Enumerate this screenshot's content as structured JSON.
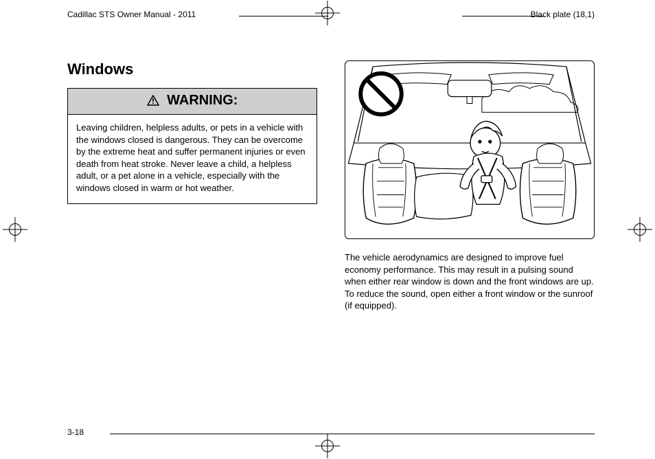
{
  "header": {
    "left": "Cadillac STS Owner Manual - 2011",
    "right": "Black plate (18,1)"
  },
  "section_title": "Windows",
  "warning": {
    "label": "WARNING:",
    "icon_name": "warning-triangle-icon",
    "body": "Leaving children, helpless adults, or pets in a vehicle with the windows closed is dangerous. They can be overcome by the extreme heat and suffer permanent injuries or even death from heat stroke. Never leave a child, a helpless adult, or a pet alone in a vehicle, especially with the windows closed in warm or hot weather."
  },
  "illustration": {
    "alt": "Line drawing: child in rear seat of a car with a prohibition (no-unattended) symbol in the upper-left corner.",
    "prohibition_icon": "no-symbol-icon"
  },
  "caption": "The vehicle aerodynamics are designed to improve fuel economy performance. This may result in a pulsing sound when either rear window is down and the front windows are up. To reduce the sound, open either a front window or the sunroof (if equipped).",
  "page_number": "3-18"
}
